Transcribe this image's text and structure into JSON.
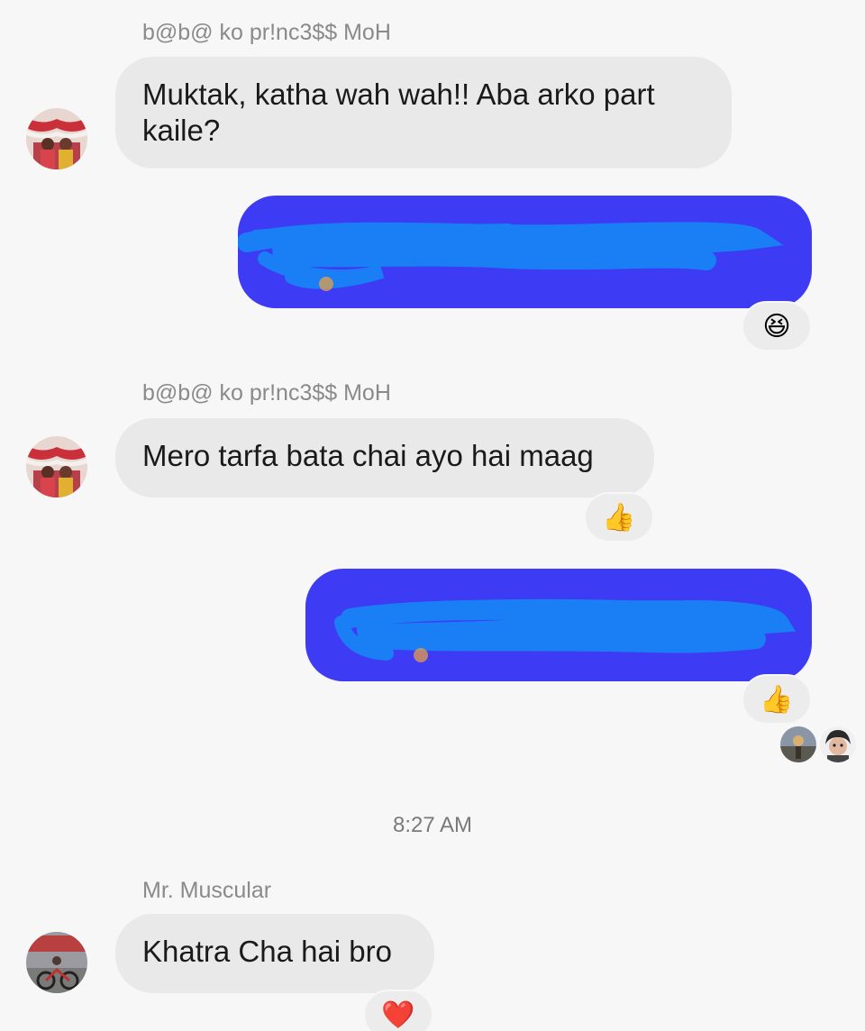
{
  "thread": {
    "messages": [
      {
        "direction": "incoming",
        "sender": "b@b@ ko pr!nc3$$ MoH",
        "text_line1": "Muktak, katha wah wah!! Aba arko part",
        "text_line2": "kaile?"
      },
      {
        "direction": "outgoing",
        "text": "",
        "redacted": true,
        "reaction": "😆"
      },
      {
        "direction": "incoming",
        "sender": "b@b@ ko pr!nc3$$ MoH",
        "text": "Mero tarfa bata chai ayo hai maag",
        "reaction": "👍"
      },
      {
        "direction": "outgoing",
        "text": "",
        "redacted": true,
        "reaction": "👍"
      },
      {
        "direction": "incoming",
        "sender": "Mr. Muscular",
        "text": "Khatra Cha hai bro",
        "reaction": "❤️"
      }
    ],
    "timestamp": "8:27 AM",
    "seen_by": [
      "seen-avatar-1",
      "seen-avatar-2"
    ]
  },
  "colors": {
    "background": "#f7f7f7",
    "incoming_bubble": "#e9e9e9",
    "outgoing_bubble": "#3d3cf4",
    "redaction_scribble": "#1a7ff5",
    "sender_name": "#8a8a8a"
  }
}
